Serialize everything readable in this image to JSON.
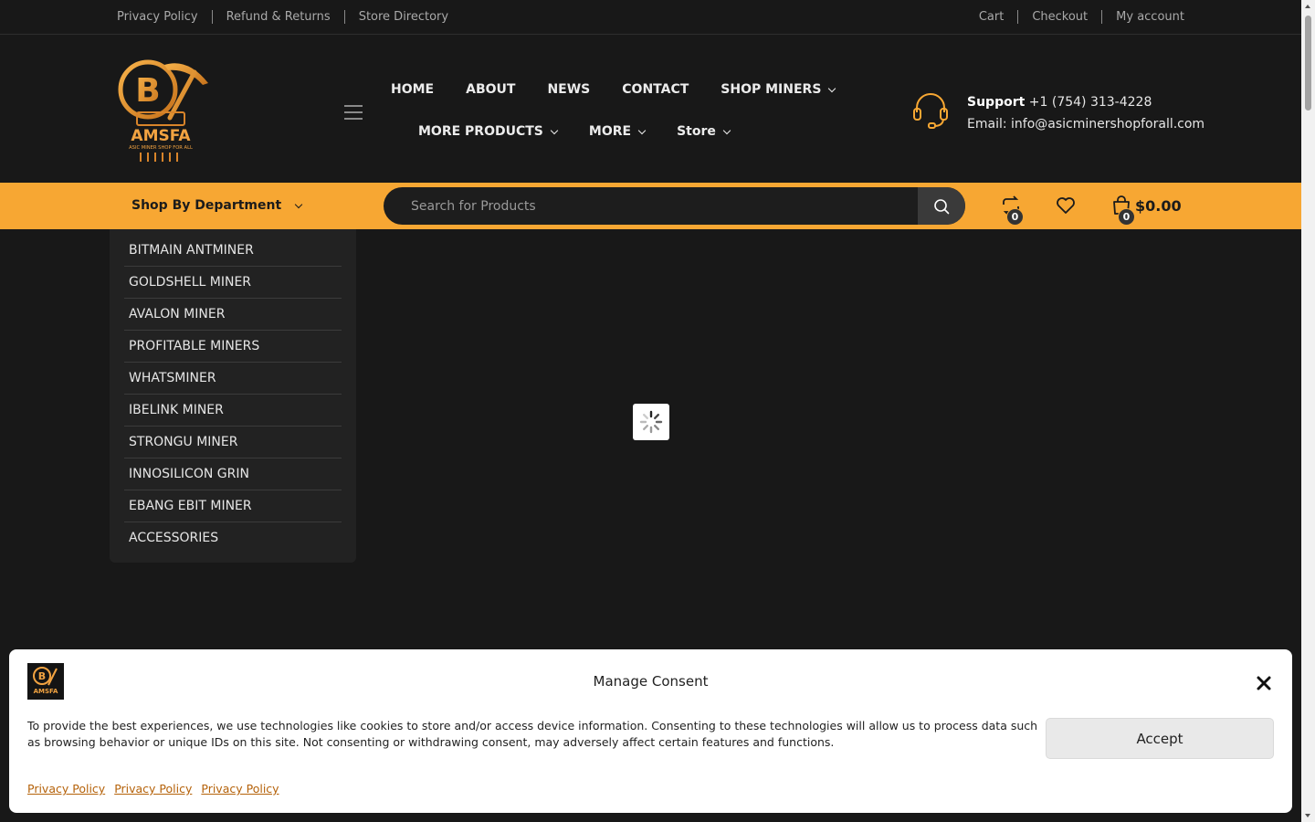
{
  "topbar": {
    "left_links": [
      "Privacy Policy",
      "Refund & Returns",
      "Store Directory"
    ],
    "right_links": [
      "Cart",
      "Checkout",
      "My account"
    ]
  },
  "brand": {
    "name": "AMSFA",
    "tagline": "ASIC MINER SHOP FOR ALL",
    "logo_symbol": "B"
  },
  "nav": {
    "row1": [
      {
        "label": "HOME",
        "dropdown": false
      },
      {
        "label": "ABOUT",
        "dropdown": false
      },
      {
        "label": "NEWS",
        "dropdown": false
      },
      {
        "label": "CONTACT",
        "dropdown": false
      },
      {
        "label": "SHOP MINERS",
        "dropdown": true
      }
    ],
    "row2": [
      {
        "label": "MORE PRODUCTS",
        "dropdown": true
      },
      {
        "label": "MORE",
        "dropdown": true
      },
      {
        "label": "Store",
        "dropdown": true
      }
    ]
  },
  "support": {
    "label": "Support",
    "phone": "+1 (754) 313-4228",
    "email_line": "Email: info@asicminershopforall.com"
  },
  "toolbar": {
    "department_label": "Shop By Department",
    "search_placeholder": "Search for Products",
    "compare_count": "0",
    "cart_count": "0",
    "cart_total": "$0.00"
  },
  "departments": [
    "BITMAIN ANTMINER",
    "GOLDSHELL MINER",
    "AVALON MINER",
    "PROFITABLE MINERS",
    "WHATSMINER",
    "IBELINK MINER",
    "STRONGU MINER",
    "INNOSILICON GRIN",
    "EBANG EBIT MINER",
    "ACCESSORIES"
  ],
  "consent": {
    "title": "Manage Consent",
    "text": "To provide the best experiences, we use technologies like cookies to store and/or access device information. Consenting to these technologies will allow us to process data such as browsing behavior or unique IDs on this site. Not consenting or withdrawing consent, may adversely affect certain features and functions.",
    "accept_label": "Accept",
    "links": [
      "Privacy Policy",
      "Privacy Policy",
      "Privacy Policy"
    ]
  },
  "colors": {
    "accent": "#f7a733",
    "background": "#181818",
    "panel": "#222222",
    "link_orange": "#b5620a"
  },
  "icons": [
    "hamburger-icon",
    "headset-icon",
    "search-icon",
    "compare-icon",
    "heart-icon",
    "bag-icon",
    "close-icon",
    "spinner-icon"
  ]
}
